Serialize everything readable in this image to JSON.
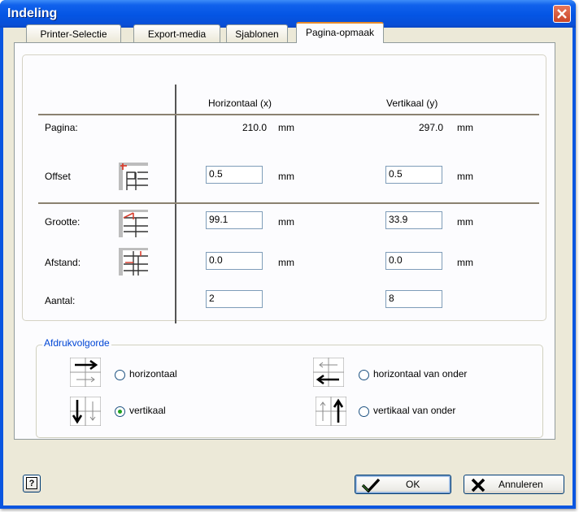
{
  "window": {
    "title": "Indeling"
  },
  "tabs": [
    {
      "label": "Printer-Selectie"
    },
    {
      "label": "Export-media"
    },
    {
      "label": "Sjablonen"
    },
    {
      "label": "Pagina-opmaak",
      "active": true
    }
  ],
  "grid": {
    "col_horizontal": "Horizontaal (x)",
    "col_vertical": "Vertikaal (y)",
    "unit": "mm",
    "rows": {
      "pagina": {
        "label": "Pagina:",
        "x": "210.0",
        "y": "297.0"
      },
      "offset": {
        "label": "Offset",
        "x": "0.5",
        "y": "0.5"
      },
      "grootte": {
        "label": "Grootte:",
        "x": "99.1",
        "y": "33.9"
      },
      "afstand": {
        "label": "Afstand:",
        "x": "0.0",
        "y": "0.0"
      },
      "aantal": {
        "label": "Aantal:",
        "x": "2",
        "y": "8"
      }
    }
  },
  "print_order": {
    "label": "Afdrukvolgorde",
    "options": {
      "horizontaal": {
        "label": "horizontaal",
        "checked": false
      },
      "vertikaal": {
        "label": "vertikaal",
        "checked": true
      },
      "horizontaal_onder": {
        "label": "horizontaal van onder",
        "checked": false
      },
      "vertikaal_onder": {
        "label": "vertikaal van onder",
        "checked": false
      }
    }
  },
  "buttons": {
    "ok": "OK",
    "cancel": "Annuleren",
    "help": "?"
  },
  "colors": {
    "titlebar": "#0455e4",
    "dialog_bg": "#ece9d8",
    "active_tab_accent": "#e68b2c",
    "group_label": "#0046d5",
    "radio_checked": "#21a121"
  }
}
